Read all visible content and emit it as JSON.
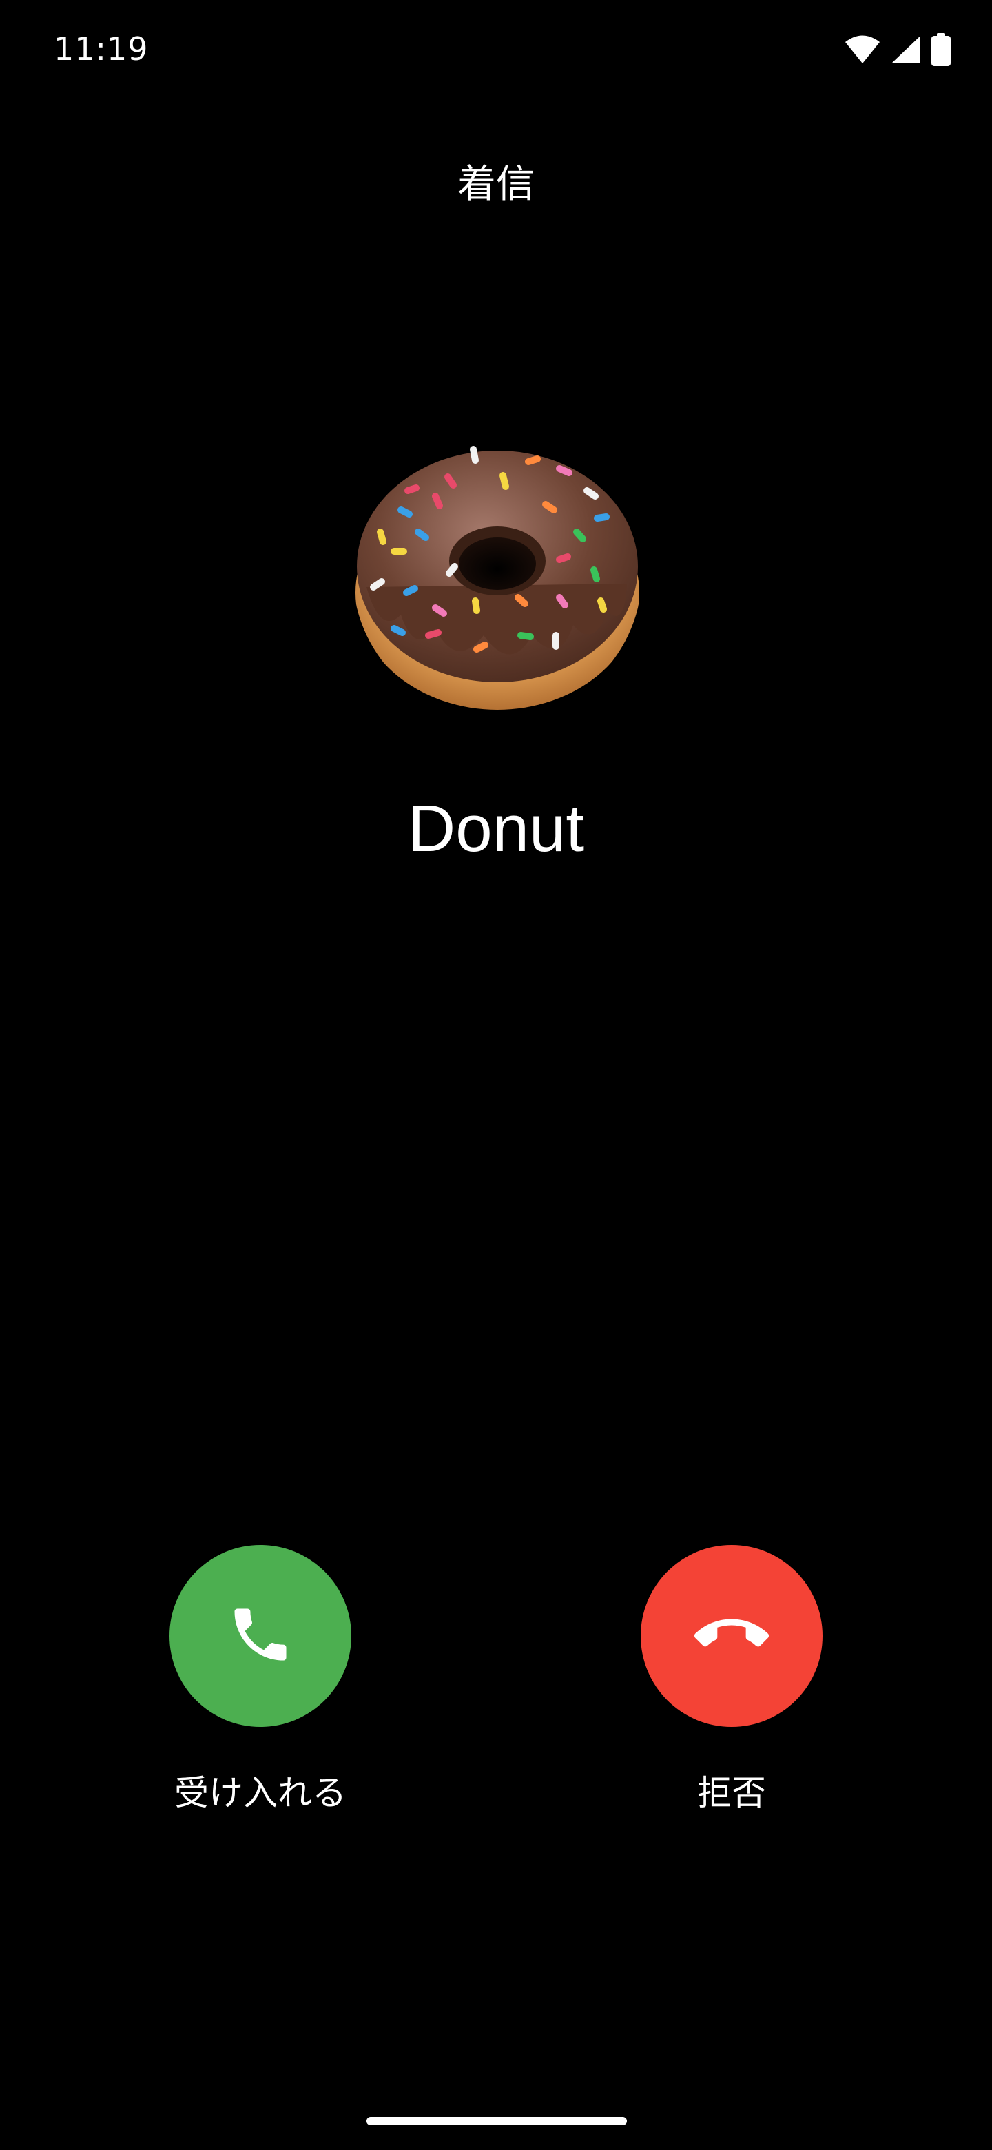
{
  "status_bar": {
    "time": "11:19",
    "icons": [
      "wifi-icon",
      "cellular-signal-icon",
      "battery-icon"
    ]
  },
  "call": {
    "header": "着信",
    "caller_name": "Donut",
    "avatar": "donut-avatar"
  },
  "actions": {
    "accept_label": "受け入れる",
    "decline_label": "拒否",
    "accept_icon": "phone-icon",
    "decline_icon": "hang-up-icon"
  },
  "colors": {
    "background": "#000000",
    "accept": "#4CAF50",
    "decline": "#F44336",
    "text": "#FFFFFF"
  }
}
